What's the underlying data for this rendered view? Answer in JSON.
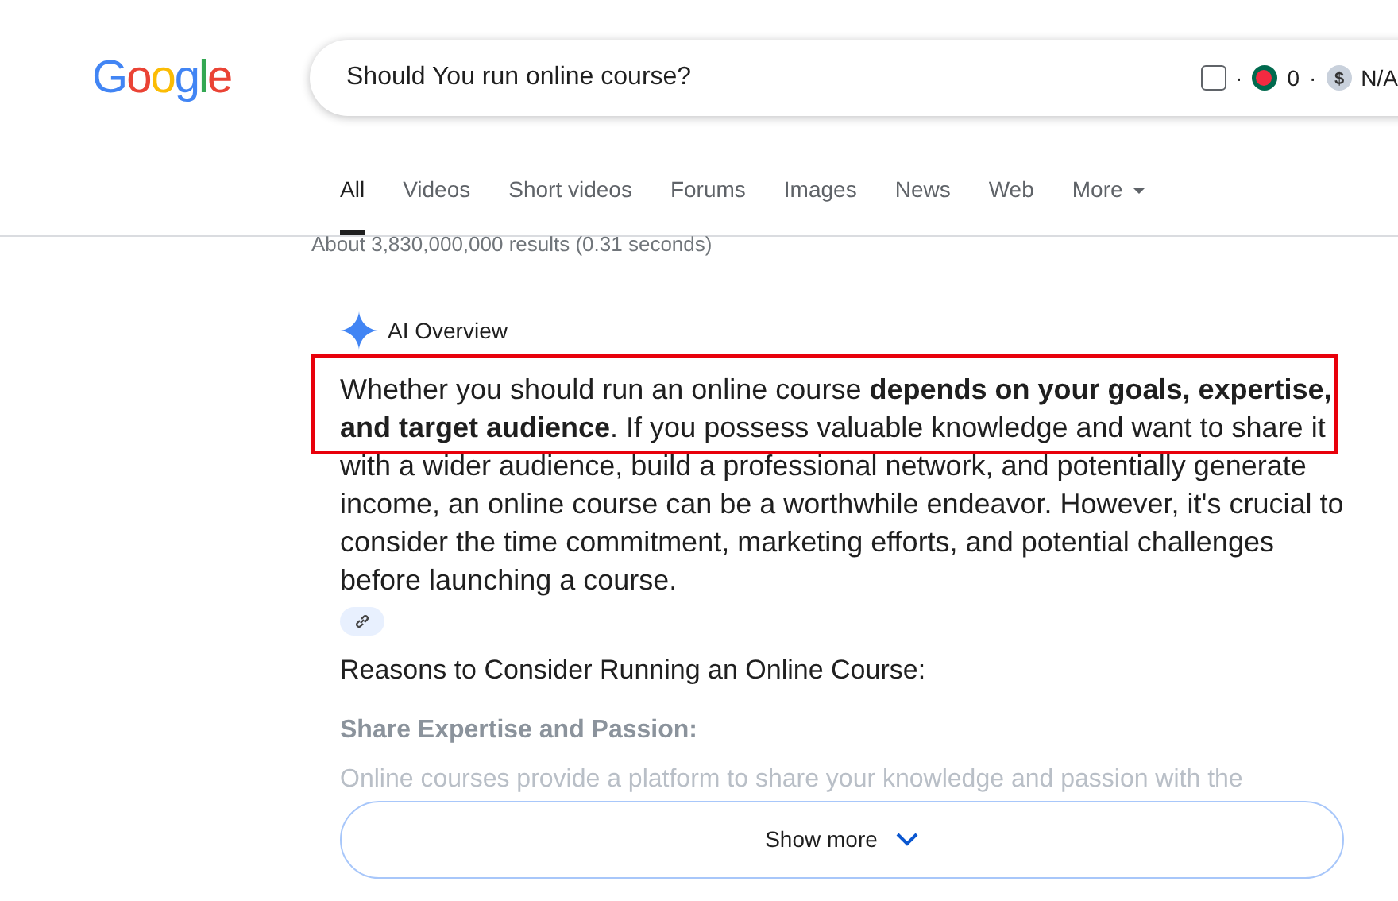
{
  "logo": {
    "text": "Google"
  },
  "search": {
    "value": "Should You run online course?",
    "extension": {
      "checked": false,
      "sep_1": "·",
      "count": "0",
      "sep_2": "·",
      "currency_symbol": "$",
      "price": "N/A"
    }
  },
  "tabs": [
    {
      "label": "All",
      "selected": true
    },
    {
      "label": "Videos",
      "selected": false
    },
    {
      "label": "Short videos",
      "selected": false
    },
    {
      "label": "Forums",
      "selected": false
    },
    {
      "label": "Images",
      "selected": false
    },
    {
      "label": "News",
      "selected": false
    },
    {
      "label": "Web",
      "selected": false
    },
    {
      "label": "More",
      "selected": false,
      "kind": "dropdown"
    }
  ],
  "result_stats": "About 3,830,000,000 results (0.31 seconds)",
  "ai_overview": {
    "title": "AI Overview",
    "annotated": true,
    "paragraph": "Whether you should run an online course **depends on your goals, expertise, and target audience**. If you possess valuable knowledge and want to share it with a wider audience, build a professional network, and potentially generate income, an online course can be a worthwhile endeavor. However, it's crucial to consider the time commitment, marketing efforts, and potential challenges before launching a course.",
    "heading": "Reasons to Consider Running an Online Course:",
    "subheading": "Share Expertise and Passion:",
    "faded_text": "Online courses provide a platform to share your knowledge and passion with the",
    "show_more": "Show more"
  }
}
